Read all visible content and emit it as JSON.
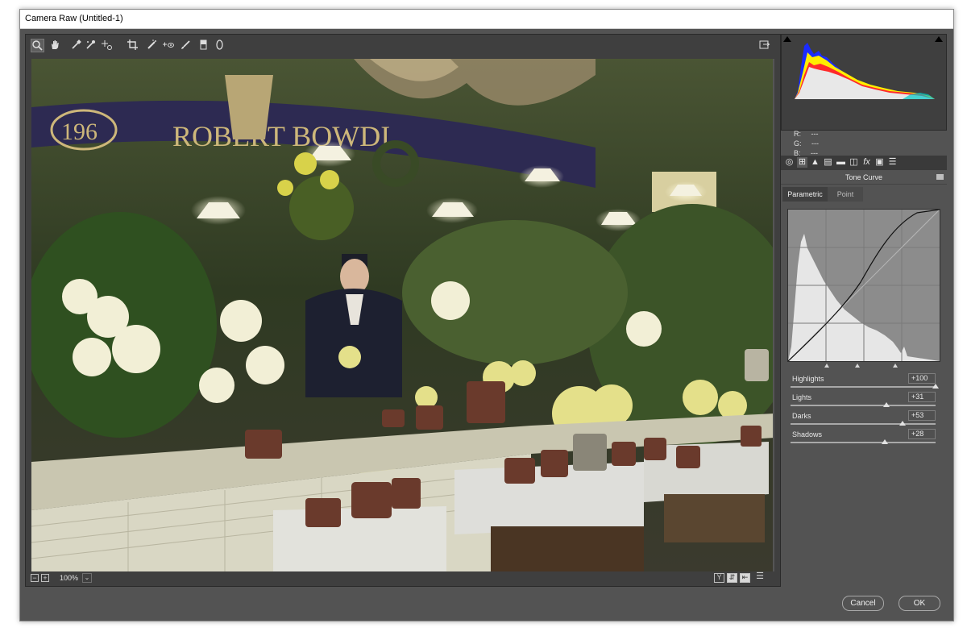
{
  "window": {
    "title": "Camera Raw (Untitled-1)"
  },
  "toolbar": {
    "tools": [
      {
        "icon": "zoom-icon",
        "glyph": "🔍︎"
      },
      {
        "icon": "hand-icon",
        "glyph": "✋︎"
      },
      {
        "icon": "white-balance-icon",
        "glyph": "✒"
      },
      {
        "icon": "color-sampler-icon",
        "glyph": "✒"
      },
      {
        "icon": "targeted-adjustment-icon",
        "glyph": "⊹"
      },
      {
        "icon": "crop-icon",
        "glyph": "⌗"
      },
      {
        "icon": "spot-removal-icon",
        "glyph": "✎"
      },
      {
        "icon": "red-eye-icon",
        "glyph": "+◉"
      },
      {
        "icon": "adjustment-brush-icon",
        "glyph": "✎"
      },
      {
        "icon": "graduated-filter-icon",
        "glyph": "▥"
      },
      {
        "icon": "radial-filter-icon",
        "glyph": "◯"
      }
    ],
    "export_icon": "open-preferences-icon"
  },
  "status": {
    "zoom": "100%"
  },
  "histogram": {
    "r_label": "R:",
    "g_label": "G:",
    "b_label": "B:",
    "r_value": "---",
    "g_value": "---",
    "b_value": "---"
  },
  "panel": {
    "title": "Tone Curve",
    "tabs": [
      {
        "label": "Parametric",
        "active": true
      },
      {
        "label": "Point",
        "active": false
      }
    ],
    "sliders": [
      {
        "label": "Highlights",
        "value": "+100",
        "position": 1.0
      },
      {
        "label": "Lights",
        "value": "+31",
        "position": 0.655
      },
      {
        "label": "Darks",
        "value": "+53",
        "position": 0.765
      },
      {
        "label": "Shadows",
        "value": "+28",
        "position": 0.64
      }
    ]
  },
  "buttons": {
    "cancel": "Cancel",
    "ok": "OK"
  },
  "colors": {
    "accent": "#4f8fe0",
    "dialog_bg": "#535353",
    "panel_dark": "#3f3f3f"
  }
}
